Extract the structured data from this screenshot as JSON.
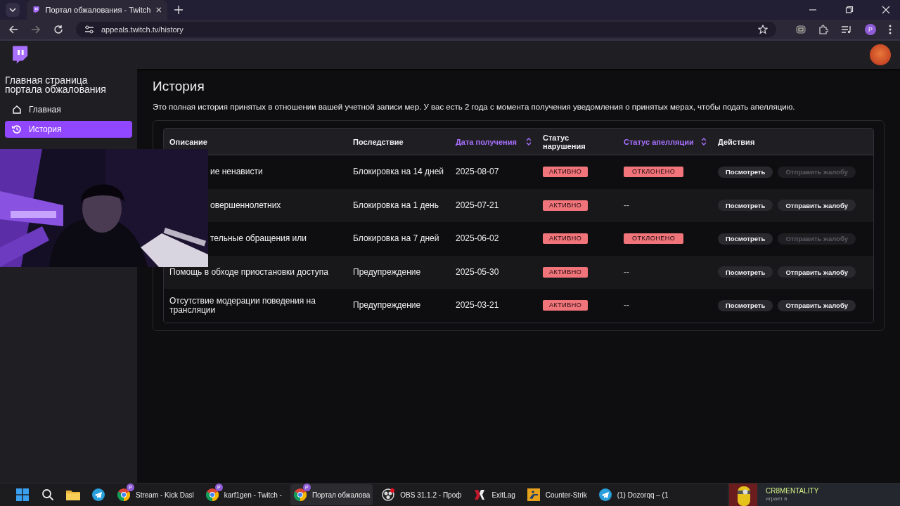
{
  "browser": {
    "tab_title": "Портал обжалования - Twitch",
    "url": "appeals.twitch.tv/history",
    "profile_initial": "P"
  },
  "sidebar": {
    "title": "Главная страница портала обжалования",
    "items": [
      {
        "label": "Главная",
        "kind": "home",
        "selected": false
      },
      {
        "label": "История",
        "kind": "history",
        "selected": true
      }
    ]
  },
  "page": {
    "title": "История",
    "intro": "Это полная история принятых в отношении вашей учетной записи мер. У вас есть 2 года с момента получения уведомления о принятых мерах, чтобы подать апелляцию."
  },
  "table": {
    "columns": [
      {
        "label": "Описание",
        "sortable": false
      },
      {
        "label": "Последствие",
        "sortable": false
      },
      {
        "label": "Дата получения",
        "sortable": true
      },
      {
        "label": "Статус нарушения",
        "sortable": false
      },
      {
        "label": "Статус апелляции",
        "sortable": true
      },
      {
        "label": "Действия",
        "sortable": false
      }
    ],
    "rows": [
      {
        "description": "ие ненависти",
        "covered": true,
        "consequence": "Блокировка на 14 дней",
        "date": "2025-08-07",
        "violation_status": "АКТИВНО",
        "appeal_status": {
          "kind": "badge",
          "text": "ОТКЛОНЕНО"
        },
        "actions": [
          {
            "label": "Посмотреть",
            "disabled": false
          },
          {
            "label": "Отправить жалобу",
            "disabled": true
          }
        ]
      },
      {
        "description": "овершеннолетних",
        "covered": true,
        "consequence": "Блокировка на 1 день",
        "date": "2025-07-21",
        "violation_status": "АКТИВНО",
        "appeal_status": {
          "kind": "plain",
          "text": "--"
        },
        "actions": [
          {
            "label": "Посмотреть",
            "disabled": false
          },
          {
            "label": "Отправить жалобу",
            "disabled": false
          }
        ]
      },
      {
        "description": "тельные обращения или",
        "covered": true,
        "consequence": "Блокировка на 7 дней",
        "date": "2025-06-02",
        "violation_status": "АКТИВНО",
        "appeal_status": {
          "kind": "badge",
          "text": "ОТКЛОНЕНО"
        },
        "actions": [
          {
            "label": "Посмотреть",
            "disabled": false
          },
          {
            "label": "Отправить жалобу",
            "disabled": true
          }
        ]
      },
      {
        "description": "Помощь в обходе приостановки доступа",
        "covered": false,
        "consequence": "Предупреждение",
        "date": "2025-05-30",
        "violation_status": "АКТИВНО",
        "appeal_status": {
          "kind": "plain",
          "text": "--"
        },
        "actions": [
          {
            "label": "Посмотреть",
            "disabled": false
          },
          {
            "label": "Отправить жалобу",
            "disabled": false
          }
        ]
      },
      {
        "description": "Отсутствие модерации поведения на трансляции",
        "covered": false,
        "consequence": "Предупреждение",
        "date": "2025-03-21",
        "violation_status": "АКТИВНО",
        "appeal_status": {
          "kind": "plain",
          "text": "--"
        },
        "actions": [
          {
            "label": "Посмотреть",
            "disabled": false
          },
          {
            "label": "Отправить жалобу",
            "disabled": false
          }
        ]
      }
    ]
  },
  "taskbar": {
    "items": [
      {
        "kind": "start",
        "selected": false
      },
      {
        "kind": "search",
        "selected": false
      },
      {
        "kind": "folder",
        "selected": false
      },
      {
        "kind": "telegram",
        "selected": false
      },
      {
        "kind": "chrome",
        "label": "Stream - Kick Dasl",
        "badge": "P",
        "selected": false
      },
      {
        "kind": "chrome",
        "label": "karf1gen - Twitch -",
        "badge": "P",
        "selected": false
      },
      {
        "kind": "chrome",
        "label": "Портал обжалова",
        "badge": "P",
        "selected": true
      },
      {
        "kind": "obs",
        "label": "OBS 31.1.2 - Проф",
        "selected": false
      },
      {
        "kind": "exitlag",
        "label": "ExitLag",
        "selected": false
      },
      {
        "kind": "cs",
        "label": "Counter-Strik",
        "selected": false
      },
      {
        "kind": "telegram",
        "label": "(1) Dozorqq – (1",
        "selected": false
      }
    ],
    "notification": {
      "name": "CR8MENTALITY",
      "status": "играет в"
    }
  }
}
